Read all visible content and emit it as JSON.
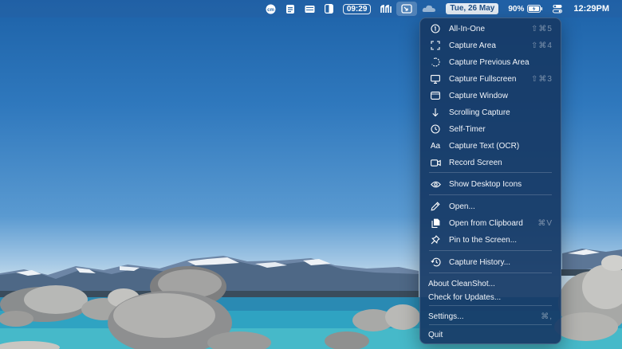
{
  "menubar": {
    "icons": [
      "cm-app-icon",
      "stack-app-icon",
      "keyboard-app-icon",
      "sidebar-app-icon",
      "music-app-icon",
      "cleanshot-icon",
      "cloud-icon",
      "battery-icon",
      "control-center-icon"
    ],
    "timer": "09:29",
    "date": "Tue, 26 May",
    "battery_percent": "90%",
    "clock": "12:29PM",
    "cm_label": "cm"
  },
  "menu": {
    "capture_items": [
      {
        "label": "All-In-One",
        "shortcut": "⇧⌘5",
        "icon": "all-in-one-icon"
      },
      {
        "label": "Capture Area",
        "shortcut": "⇧⌘4",
        "icon": "capture-area-icon"
      },
      {
        "label": "Capture Previous Area",
        "shortcut": "",
        "icon": "previous-area-icon"
      },
      {
        "label": "Capture Fullscreen",
        "shortcut": "⇧⌘3",
        "icon": "display-icon"
      },
      {
        "label": "Capture Window",
        "shortcut": "",
        "icon": "window-icon"
      },
      {
        "label": "Scrolling Capture",
        "shortcut": "",
        "icon": "arrow-down-icon"
      },
      {
        "label": "Self-Timer",
        "shortcut": "",
        "icon": "timer-icon"
      },
      {
        "label": "Capture Text (OCR)",
        "shortcut": "",
        "icon": "text-aa-icon"
      },
      {
        "label": "Record Screen",
        "shortcut": "",
        "icon": "video-camera-icon"
      }
    ],
    "show_desktop_icons": "Show Desktop Icons",
    "open": "Open...",
    "open_from_clipboard": "Open from Clipboard",
    "open_from_clipboard_shortcut": "⌘V",
    "pin_to_screen": "Pin to the Screen...",
    "capture_history": "Capture History...",
    "about": "About CleanShot...",
    "check_updates": "Check for Updates...",
    "settings": "Settings...",
    "settings_shortcut": "⌘,",
    "quit": "Quit",
    "aa_glyph": "Aa"
  }
}
